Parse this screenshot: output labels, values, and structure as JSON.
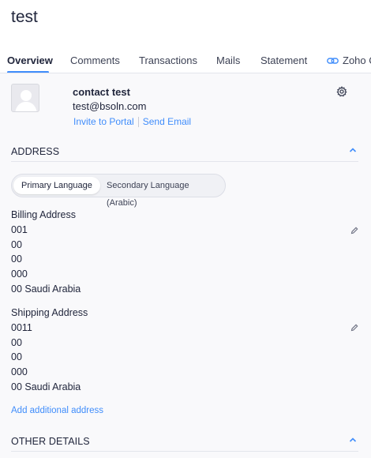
{
  "page": {
    "title": "test"
  },
  "tabs": [
    {
      "label": "Overview"
    },
    {
      "label": "Comments"
    },
    {
      "label": "Transactions"
    },
    {
      "label": "Mails"
    },
    {
      "label": "Statement"
    },
    {
      "label": "Zoho C"
    }
  ],
  "contact": {
    "name": "contact test",
    "email": "test@bsoln.com",
    "invite_label": "Invite to Portal",
    "send_email_label": "Send Email"
  },
  "address_section": {
    "title": "ADDRESS",
    "languages": [
      "Primary Language",
      "Secondary Language (Arabic)"
    ],
    "billing": {
      "heading": "Billing Address",
      "lines": [
        "001",
        "00",
        "00",
        "000",
        "00 Saudi Arabia"
      ]
    },
    "shipping": {
      "heading": "Shipping Address",
      "lines": [
        "0011",
        "00",
        "00",
        "000",
        "00 Saudi Arabia"
      ]
    },
    "add_label": "Add additional address"
  },
  "other_section": {
    "title": "OTHER DETAILS"
  },
  "colors": {
    "accent": "#408dfb",
    "panel_bg": "#f9f9fb",
    "text": "#21263c"
  },
  "icons": [
    "avatar-placeholder-icon",
    "gear-icon",
    "chevron-up-icon",
    "pencil-icon",
    "link-icon"
  ]
}
